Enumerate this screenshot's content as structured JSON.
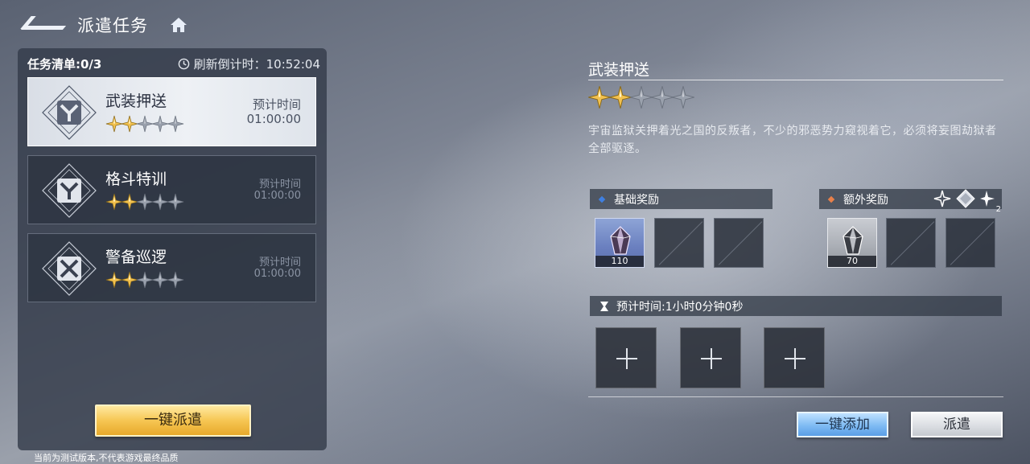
{
  "header": {
    "title": "派遣任务"
  },
  "left_panel": {
    "list_label": "任务清单:0/3",
    "refresh_label": "刷新倒计时：10:52:04"
  },
  "tasks": [
    {
      "name": "武装押送",
      "stars": 2,
      "max_stars": 5,
      "time_label": "预计时间",
      "time_value": "01:00:00",
      "selected": true,
      "icon": "shield-emblem-icon"
    },
    {
      "name": "格斗特训",
      "stars": 2,
      "max_stars": 5,
      "time_label": "预计时间",
      "time_value": "01:00:00",
      "selected": false,
      "icon": "shield-emblem-icon"
    },
    {
      "name": "警备巡逻",
      "stars": 2,
      "max_stars": 5,
      "time_label": "预计时间",
      "time_value": "01:00:00",
      "selected": false,
      "icon": "crossed-emblem-icon"
    }
  ],
  "dispatch_all_label": "一键派遣",
  "disclaimer": "当前为测试版本,不代表游戏最终品质",
  "detail": {
    "title": "武装押送",
    "stars": 2,
    "max_stars": 5,
    "description": "宇宙监狱关押着光之国的反叛者，不少的邪恶势力窥视着它，必须将妄图劫狱者全部驱逐。",
    "basic_reward_label": "基础奖励",
    "extra_reward_label": "额外奖励",
    "basic_rewards": [
      {
        "qty": "110",
        "rarity": "blue",
        "icon": "crystal-icon"
      }
    ],
    "extra_rewards": [
      {
        "qty": "70",
        "rarity": "gray",
        "icon": "crystal-icon"
      }
    ],
    "extra_condition_badge": "2",
    "estimated_time_label": "预计时间:1小时0分钟0秒",
    "add_all_label": "一键添加",
    "dispatch_label": "派遣"
  },
  "colors": {
    "star_gold": "#f2c14e",
    "star_empty": "#9aa1ad",
    "basic_diamond": "#3f7fe0",
    "extra_diamond": "#e8804a"
  }
}
